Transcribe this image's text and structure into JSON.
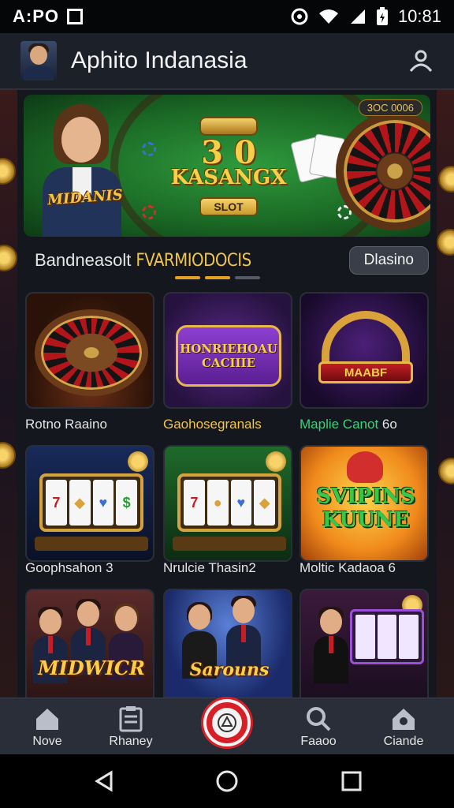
{
  "status_bar": {
    "left_text": "A:PO",
    "clock": "10:81",
    "icons": [
      "notification-square-icon",
      "alarm-icon",
      "wifi-icon",
      "signal-icon",
      "battery-icon"
    ]
  },
  "app_bar": {
    "title": "Aphito Indanasia",
    "profile_icon": "person-icon"
  },
  "banner": {
    "top_right_badge": "3OC 0006",
    "big_number": "3 0",
    "big_word": "KASANGX",
    "slot_plaque": "SLOT",
    "left_label": "MIDANIS"
  },
  "section": {
    "label_primary": "Bandneasolt",
    "label_accent": "FVARMIODOCIS",
    "button_label": "Dlasino",
    "indicator_colors": [
      "#e6a21c",
      "#e6a21c",
      "#555a66"
    ]
  },
  "games": [
    {
      "caption": "Rotno Raaino",
      "caption_color": "#e4e4e4",
      "art_text": ""
    },
    {
      "caption": "Gaohosegranals",
      "caption_color": "#f0c54a",
      "art_text": "HONRIEHOAU CACIIIE"
    },
    {
      "caption": "Maplie Canot",
      "caption_color": "#3ad17a",
      "caption_suffix": "6o",
      "art_text": "MAABF"
    },
    {
      "caption": "Goophsahon 3",
      "caption_color": "#e4e4e4",
      "art_text": ""
    },
    {
      "caption": "Nrulcie Thasin2",
      "caption_color": "#e4e4e4",
      "art_text": ""
    },
    {
      "caption": "Moltic Kadaoa 6",
      "caption_color": "#e4e4e4",
      "art_text": "SVIPINS KUUNE"
    },
    {
      "caption": "",
      "art_text": "MIDWICR"
    },
    {
      "caption": "",
      "art_text": "Sarouns"
    },
    {
      "caption": "",
      "art_text": ""
    }
  ],
  "bottom_nav": [
    {
      "label": "Nove",
      "icon": "home-icon"
    },
    {
      "label": "Rhaney",
      "icon": "clipboard-icon"
    },
    {
      "label": "",
      "icon": "casino-chip-icon"
    },
    {
      "label": "Faaoo",
      "icon": "search-icon"
    },
    {
      "label": "Ciande",
      "icon": "settings-house-icon"
    }
  ],
  "system_nav": [
    "back-icon",
    "home-circle-icon",
    "recents-icon"
  ]
}
